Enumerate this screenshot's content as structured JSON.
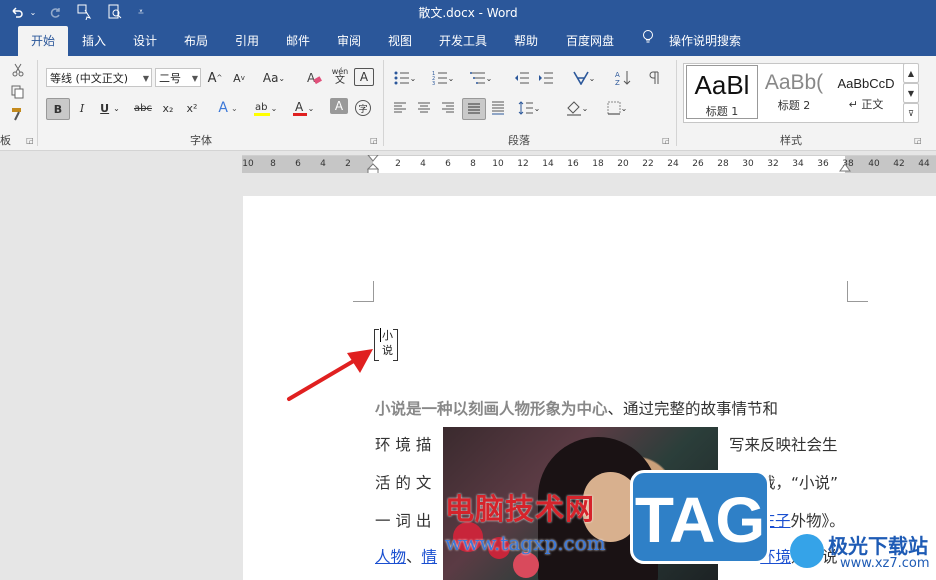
{
  "window": {
    "title": "散文.docx  -  Word"
  },
  "quick_access": {
    "icons": [
      "undo-icon",
      "redo-icon",
      "touch-mode-icon",
      "print-preview-icon",
      "customize-icon"
    ]
  },
  "tabs": [
    {
      "label": "开始",
      "active": true
    },
    {
      "label": "插入"
    },
    {
      "label": "设计"
    },
    {
      "label": "布局"
    },
    {
      "label": "引用"
    },
    {
      "label": "邮件"
    },
    {
      "label": "审阅"
    },
    {
      "label": "视图"
    },
    {
      "label": "开发工具"
    },
    {
      "label": "帮助"
    },
    {
      "label": "百度网盘"
    },
    {
      "label": "操作说明搜索"
    }
  ],
  "ribbon": {
    "font_name": "等线 (中文正文)",
    "font_size": "二号",
    "font_grow": "A",
    "font_shrink": "A",
    "change_case": "Aa",
    "phonetic": "wén",
    "bold": "B",
    "italic": "I",
    "underline": "U",
    "strike": "abc",
    "subscript": "x₂",
    "superscript": "x²",
    "enclosed_char": "字",
    "group_font": "字体",
    "group_paragraph": "段落",
    "group_styles": "样式",
    "group_clipboard_partial": "板",
    "styles": [
      {
        "sample": "AaBl",
        "name": "标题 1"
      },
      {
        "sample": "AaBb(",
        "name": "标题 2"
      },
      {
        "sample": "AaBbCcD",
        "name": "↵ 正文"
      }
    ]
  },
  "ruler": {
    "ticks": [
      "10",
      "8",
      "6",
      "4",
      "2",
      "2",
      "4",
      "6",
      "8",
      "10",
      "12",
      "14",
      "16",
      "18",
      "20",
      "22",
      "24",
      "26",
      "28",
      "30",
      "32",
      "34",
      "36",
      "38",
      "40",
      "42",
      "44"
    ]
  },
  "document": {
    "heading_chars": [
      "小",
      "说"
    ],
    "lines": {
      "l1_bold": "小说是一种以刻画人物形象为中心",
      "l1_rest": "、通过完整的故事情节和",
      "l2_left": "环 境 描",
      "l2_right": "写来反映社会生",
      "l3_left": "活 的 文",
      "l3_right": "学体裁，“小说”",
      "l4_left": "一 词 出",
      "l4_right_link": "庄子",
      "l4_right_pre": "自",
      "l4_right_post": "外物》。",
      "l5_link1": "人物",
      "l5_sep": "、",
      "l5_link2": "情",
      "l5_right_pre": "节、",
      "l5_right_link": "环境",
      "l5_right_post": "是小说"
    }
  },
  "watermarks": {
    "cn_text": "电脑技术网",
    "url_text": "www.tagxp.com",
    "badge": "TAG",
    "site_cn": "极光下载站",
    "site_en": "www.xz7.com"
  },
  "colors": {
    "brand": "#2b579a",
    "arrow": "#e02020",
    "link": "#1a4fd0"
  }
}
